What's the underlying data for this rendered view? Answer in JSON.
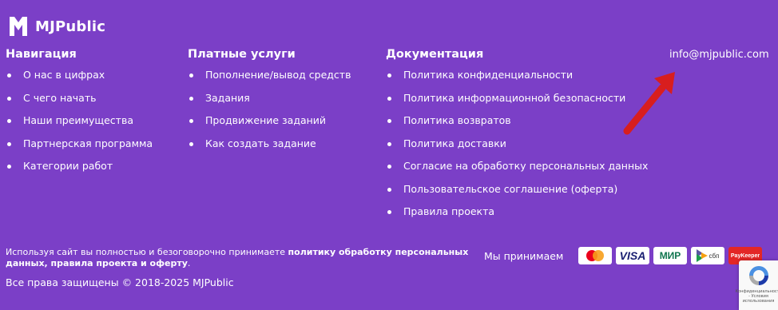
{
  "brand": {
    "name": "MJPublic"
  },
  "columns": {
    "navigation": {
      "title": "Навигация",
      "items": [
        "О нас в цифрах",
        "С чего начать",
        "Наши преимущества",
        "Партнерская программа",
        "Категории работ"
      ]
    },
    "paid_services": {
      "title": "Платные услуги",
      "items": [
        "Пополнение/вывод средств",
        "Задания",
        "Продвижение заданий",
        "Как создать задание"
      ]
    },
    "documentation": {
      "title": "Документация",
      "items": [
        "Политика конфиденциальности",
        "Политика информационной безопасности",
        "Политика возвратов",
        "Политика доставки",
        "Согласие на обработку персональных данных",
        "Пользовательское соглашение (оферта)",
        "Правила проекта"
      ]
    }
  },
  "contact": {
    "email": "info@mjpublic.com"
  },
  "footer": {
    "disclaimer_prefix": "Используя сайт вы полностью и безоговорочно принимаете ",
    "disclaimer_link": "политику обработку персональных данных, правила проекта и оферту",
    "disclaimer_suffix": ".",
    "copyright": "Все права защищены © 2018-2025 MJPublic",
    "we_accept": "Мы принимаем"
  },
  "payments": {
    "visa": "VISA",
    "mir": "МИР",
    "sbp": "сбп",
    "paykeeper": "PayKeeper"
  },
  "recaptcha": {
    "text": "Конфиденциальность - Условия использования"
  },
  "colors": {
    "background": "#7b3fc7",
    "arrow": "#d81e1e"
  }
}
